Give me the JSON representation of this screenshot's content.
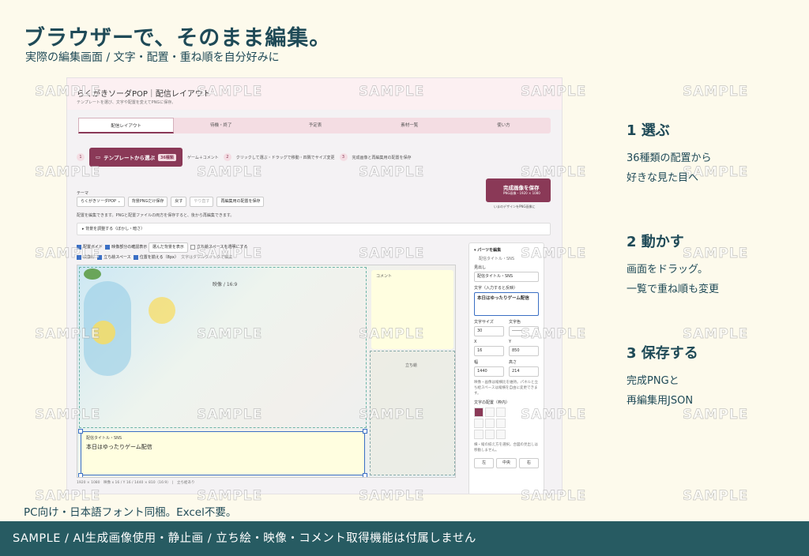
{
  "hero": {
    "title": "ブラウザーで、そのまま編集。",
    "subtitle": "実際の編集画面 / 文字・配置・重ね順を自分好みに"
  },
  "app": {
    "title": "らくがきソーダPOP｜配信レイアウト",
    "description": "テンプレートを選び、文字や配置を変えてPNGに保存。",
    "tabs": [
      "配信レイアウト",
      "待機・終了",
      "予定表",
      "素材一覧",
      "使い方"
    ],
    "steps": {
      "s1": "1",
      "template_button": "テンプレートから選ぶ",
      "template_badge": "36種類",
      "after_button": "ゲーム＋コメント",
      "s2": "2",
      "s2_text": "クリックして選ぶ・ドラッグで移動・四隅でサイズ変更",
      "s3": "3",
      "s3_text": "完成画像と再編集用の配置を保存"
    },
    "save": {
      "label": "完成画像を保存",
      "sub": "PNG画像・1920 × 1080",
      "note": "いまのデザインをPNG画像に"
    },
    "theme": {
      "label": "テーマ",
      "select": "らくがきソーダPOP",
      "bg_png": "背景PNGだけ保存",
      "undo": "戻す",
      "redo": "やり直す",
      "save_layout": "再編集用の配置を保存"
    },
    "edit_note": "配置を編集できます。PNGと配置ファイルの両方を保存すると、後から再編集できます。",
    "bg_adjust": "▸ 背景を調整する（ぼかし・暗さ）",
    "options": {
      "guide": "配置ガイド",
      "video_check": "映像部分の確認表示",
      "video_select": "選んだ背景を表示",
      "transparent": "立ち絵スペースを透明にする",
      "mask": "映像枠",
      "stand_space": "立ち絵スペース",
      "snap": "位置を揃える（8px）",
      "hint": "文字はダブルクリックで編集"
    },
    "canvas": {
      "video_label": "映像 / 16:9",
      "comment_label": "コメント",
      "stand_label": "立ち絵",
      "title_label": "配信タイトル・SNS",
      "title_text": "本日はゆったりゲーム配信",
      "footer": "1920 × 1080　映像 x 16 / Y 16 / 1440 × 810（16:9）　|　立ち絵あり"
    },
    "panel": {
      "header": "▾ パーツを編集",
      "part_name": "配信タイトル・SNS",
      "heading_label": "見出し",
      "heading_value": "配信タイトル・SNS",
      "text_label": "文字（入力すると反映）",
      "text_value": "本日はゆったりゲーム配信",
      "size_label": "文字サイズ",
      "size_value": "30",
      "color_label": "文字色",
      "x_label": "X",
      "x_value": "16",
      "y_label": "Y",
      "y_value": "850",
      "w_label": "幅",
      "w_value": "1440",
      "h_label": "高さ",
      "h_value": "214",
      "note": "映像・画像は縦横比を維持。パネルと立ち絵スペースは縦横を自由に変更できます。",
      "align_label": "文字の配置（枠内）",
      "align_note": "横・縦の揃え方を選択。合図の見出しは移動しません。",
      "align_left": "左",
      "align_center": "中央",
      "align_right": "右"
    }
  },
  "watermark": "SAMPLE",
  "features": [
    {
      "title": "1  選ぶ",
      "line1": "36種類の配置から",
      "line2": "好きな見た目へ"
    },
    {
      "title": "2  動かす",
      "line1": "画面をドラッグ。",
      "line2": "一覧で重ね順も変更"
    },
    {
      "title": "3  保存する",
      "line1": "完成PNGと",
      "line2": "再編集用JSON"
    }
  ],
  "pc_note": "PC向け・日本語フォント同梱。Excel不要。",
  "footer": "SAMPLE / AI生成画像使用・静止画 / 立ち絵・映像・コメント取得機能は付属しません",
  "colors": {
    "accent": "#8a3957",
    "brand": "#275b62",
    "background": "#fdfaec"
  }
}
